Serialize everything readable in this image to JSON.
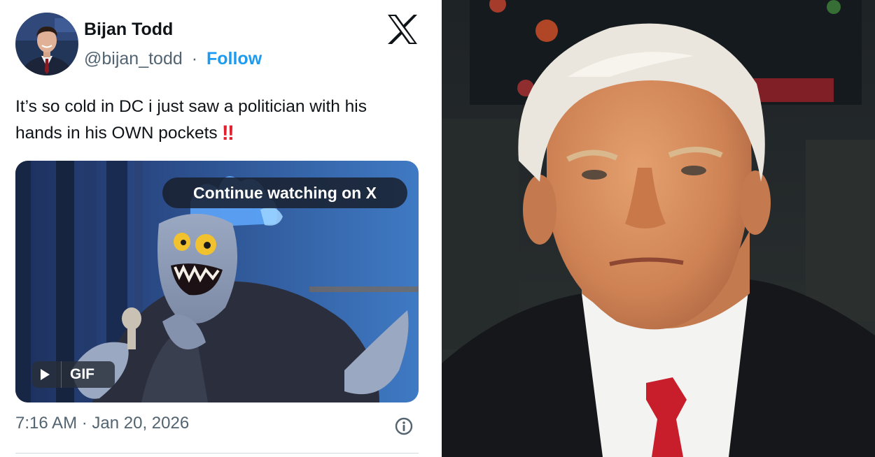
{
  "tweet": {
    "display_name": "Bijan Todd",
    "handle": "@bijan_todd",
    "separator": "·",
    "follow_label": "Follow",
    "text": "It’s so cold in DC i just saw a politician with his hands in his OWN pockets",
    "text_emoji": "‼",
    "media": {
      "continue_label": "Continue watching on X",
      "gif_label": "GIF"
    },
    "timestamp": "7:16 AM · Jan 20, 2026"
  },
  "icons": {
    "logo": "x-logo-icon",
    "info": "info-icon",
    "play": "play-icon"
  },
  "colors": {
    "follow_link": "#1d9bf0",
    "text_primary": "#0f1419",
    "text_secondary": "#536471",
    "emoji_red": "#e0202f",
    "tie_red": "#c81e2c"
  }
}
